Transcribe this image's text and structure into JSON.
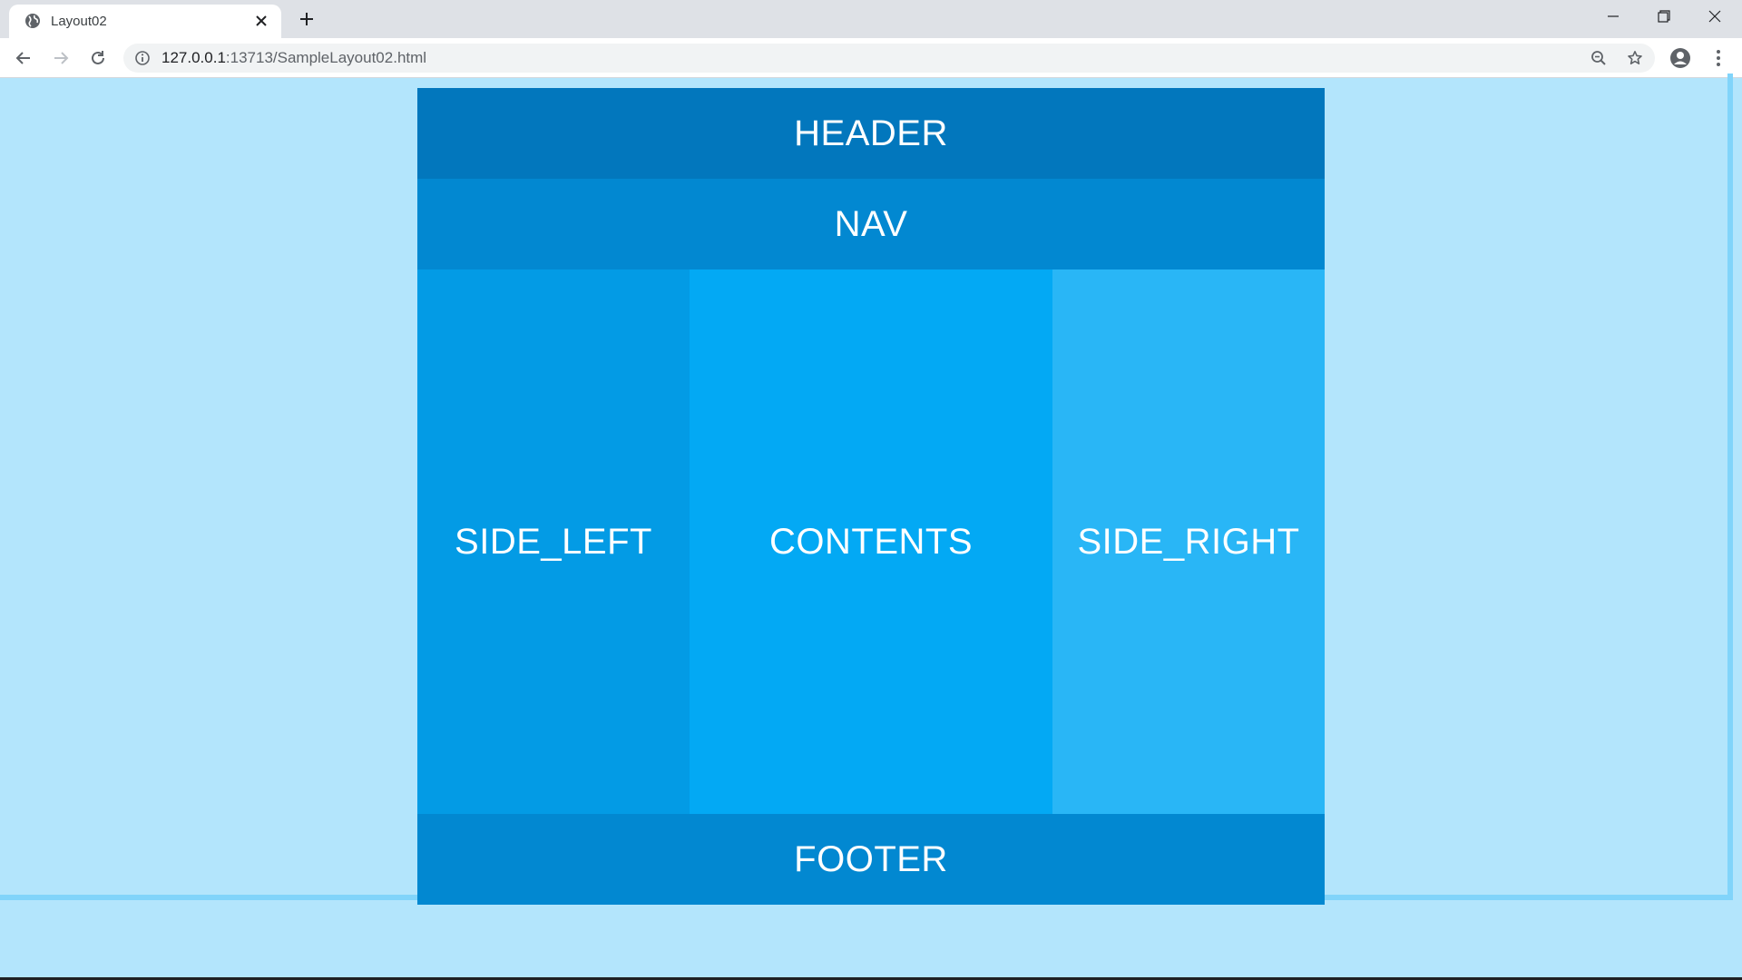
{
  "browser": {
    "tab": {
      "title": "Layout02",
      "favicon": "globe-icon",
      "close_icon": "close-icon"
    },
    "new_tab_icon": "plus-icon",
    "window_controls": [
      "minimize-icon",
      "restore-icon",
      "close-window-icon"
    ],
    "toolbar": {
      "back_icon": "arrow-left-icon",
      "forward_icon": "arrow-right-icon",
      "reload_icon": "reload-icon",
      "site_info_icon": "info-icon",
      "url_host": "127.0.0.1",
      "url_rest": ":13713/SampleLayout02.html",
      "zoom_icon": "zoom-out-icon",
      "bookmark_icon": "star-icon",
      "profile_icon": "account-icon",
      "menu_icon": "kebab-menu-icon"
    }
  },
  "page": {
    "header": "HEADER",
    "nav": "NAV",
    "side_left": "SIDE_LEFT",
    "contents": "CONTENTS",
    "side_right": "SIDE_RIGHT",
    "footer": "FOOTER"
  },
  "colors": {
    "page_background": "#b3e5fc",
    "header": "#0277bd",
    "nav": "#0288d1",
    "side_left": "#039be5",
    "contents": "#03a9f4",
    "side_right": "#29b6f6",
    "footer": "#0288d1"
  }
}
